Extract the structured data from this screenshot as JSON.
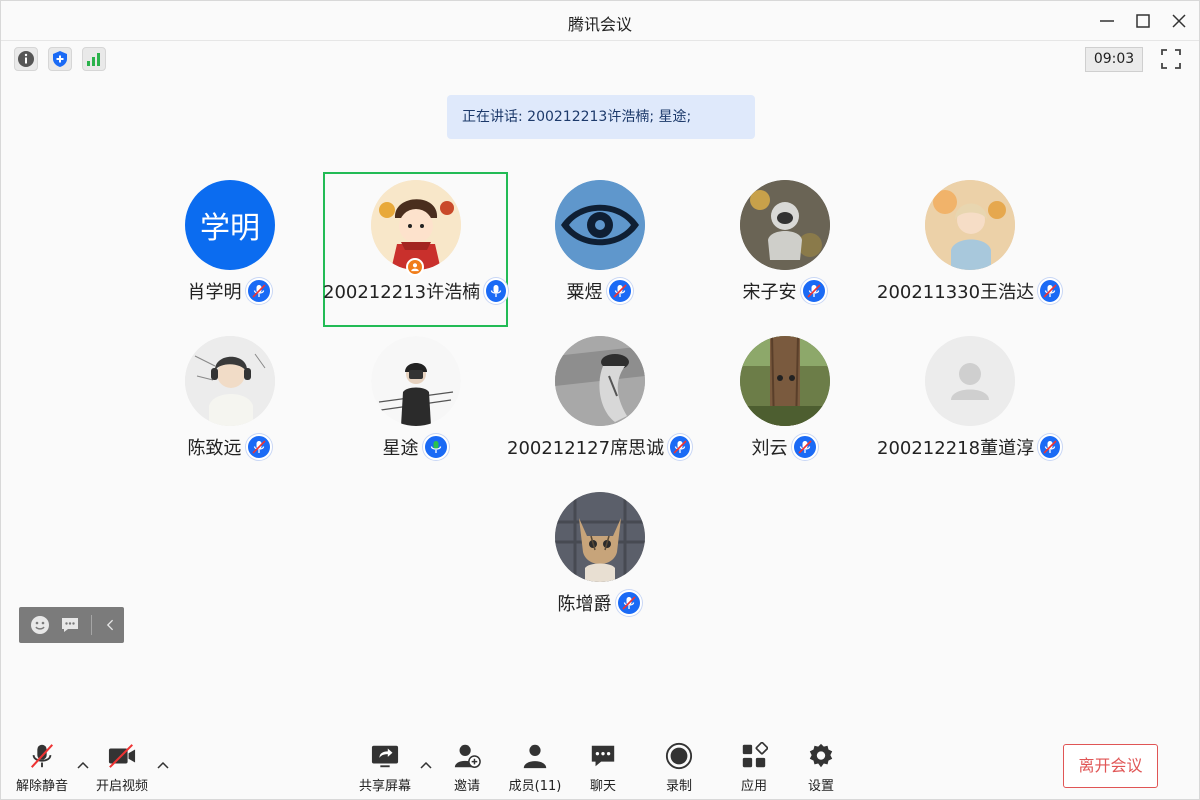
{
  "app": {
    "title": "腾讯会议"
  },
  "toolbar_top": {
    "timer": "09:03"
  },
  "speaking": {
    "text": "正在讲话: 200212213许浩楠; 星途;"
  },
  "participants": [
    {
      "name": "肖学明",
      "avatar_text": "学明",
      "mic": "muted"
    },
    {
      "name": "200212213许浩楠",
      "mic": "active",
      "host": true
    },
    {
      "name": "粟煜",
      "mic": "muted"
    },
    {
      "name": "宋子安",
      "mic": "muted"
    },
    {
      "name": "200211330王浩达",
      "mic": "muted"
    },
    {
      "name": "陈致远",
      "mic": "muted"
    },
    {
      "name": "星途",
      "mic": "speaking"
    },
    {
      "name": "200212127席思诚",
      "mic": "muted"
    },
    {
      "name": "刘云",
      "mic": "muted"
    },
    {
      "name": "200212218董道淳",
      "mic": "muted"
    },
    {
      "name": "陈增爵",
      "mic": "muted"
    }
  ],
  "bottom": {
    "unmute": "解除静音",
    "video": "开启视频",
    "share": "共享屏幕",
    "invite": "邀请",
    "members": "成员(11)",
    "chat": "聊天",
    "record": "录制",
    "apps": "应用",
    "settings": "设置",
    "leave": "离开会议"
  },
  "colors": {
    "accent": "#1a6af5",
    "highlight": "#22bb55",
    "leave": "#e05555",
    "speaking_bg": "#dfe9fb"
  }
}
